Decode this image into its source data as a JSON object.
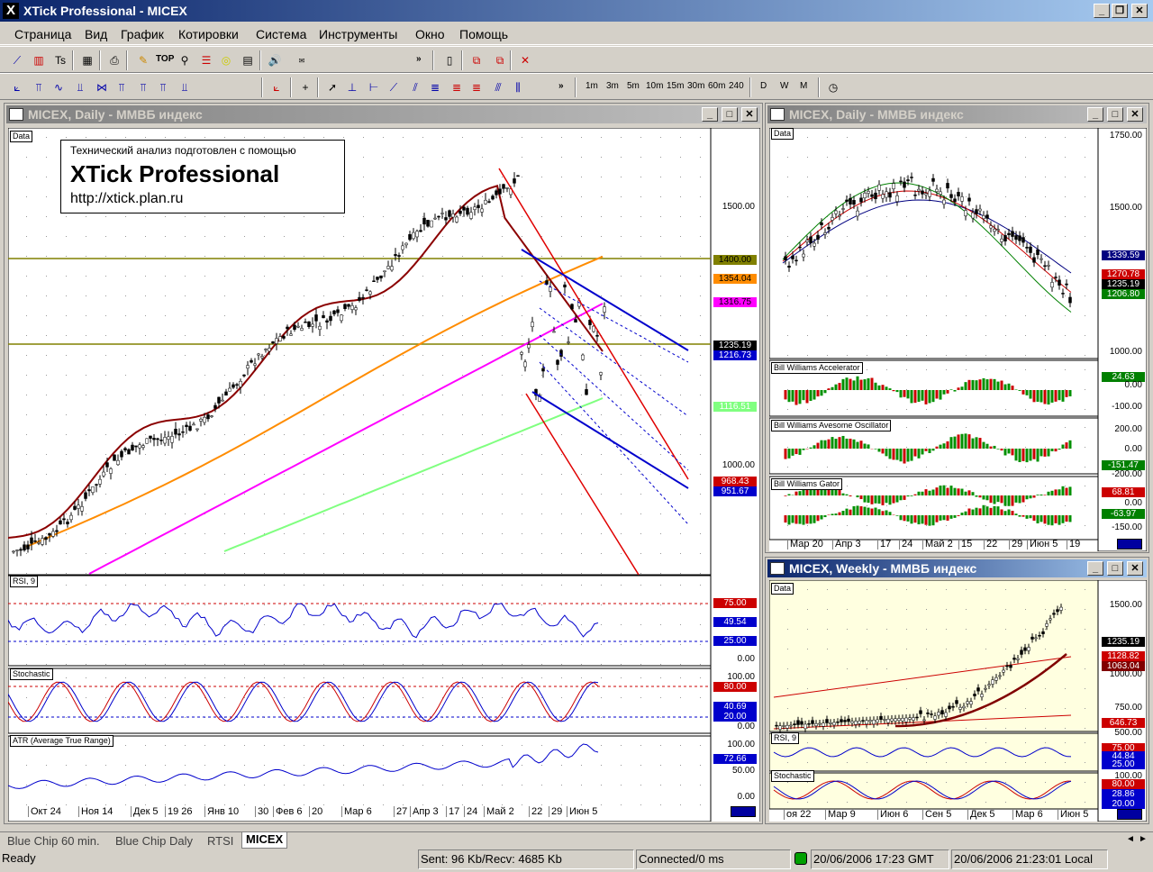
{
  "window": {
    "title": "XTick Professional - MICEX",
    "app_icon": "X"
  },
  "menu": [
    "Страница",
    "Вид",
    "График",
    "Котировки",
    "Система",
    "Инструменты",
    "Окно",
    "Помощь"
  ],
  "toolbar1": {
    "text_buttons": [
      "TOP"
    ]
  },
  "toolbar2": {
    "timeframes": [
      "1m",
      "3m",
      "5m",
      "10m",
      "15m",
      "30m",
      "60m",
      "240",
      "D",
      "W",
      "M"
    ]
  },
  "main_chart": {
    "title": "MICEX, Daily - ММВБ индекс",
    "data_label": "Data",
    "watermark": {
      "line1": "Технический анализ подготовлен с помощью",
      "line2": "XTick Professional",
      "line3": "http://xtick.plan.ru"
    },
    "price_axis": [
      "1500.00",
      "1000.00"
    ],
    "price_tags": [
      {
        "value": "1400.00",
        "bg": "#808000",
        "fg": "#000"
      },
      {
        "value": "1354.04",
        "bg": "#ff8c00",
        "fg": "#000"
      },
      {
        "value": "1316.75",
        "bg": "#ff00ff",
        "fg": "#000"
      },
      {
        "value": "1235.19",
        "bg": "#000000",
        "fg": "#fff"
      },
      {
        "value": "1216.73",
        "bg": "#0000cc",
        "fg": "#fff"
      },
      {
        "value": "1116.51",
        "bg": "#80ff80",
        "fg": "#fff"
      },
      {
        "value": "968.43",
        "bg": "#cc0000",
        "fg": "#fff"
      },
      {
        "value": "951.67",
        "bg": "#0000cc",
        "fg": "#fff"
      }
    ],
    "rsi": {
      "label": "RSI, 9",
      "levels": [
        "75.00",
        "49.54",
        "25.00",
        "0.00"
      ]
    },
    "stochastic": {
      "label": "Stochastic",
      "levels": [
        "100.00",
        "80.00",
        "40.69",
        "20.00",
        "0.00"
      ]
    },
    "atr": {
      "label": "ATR (Average True Range)",
      "levels": [
        "100.00",
        "72.66",
        "50.00",
        "0.00"
      ]
    },
    "dates": [
      "Окт 24",
      "Ноя 14",
      "Дек 5",
      "19 26",
      "Янв 10",
      "30",
      "Фев 6",
      "20",
      "Мар 6",
      "27",
      "Апр 3",
      "17",
      "24",
      "Май 2",
      "22",
      "29",
      "Июн 5"
    ]
  },
  "right_daily": {
    "title": "MICEX, Daily - ММВБ индекс",
    "data_label": "Data",
    "price_axis": [
      "1750.00",
      "1500.00",
      "1000.00"
    ],
    "price_tags": [
      {
        "value": "1339.59",
        "bg": "#000080",
        "fg": "#fff"
      },
      {
        "value": "1270.78",
        "bg": "#cc0000",
        "fg": "#fff"
      },
      {
        "value": "1235.19",
        "bg": "#000000",
        "fg": "#fff"
      },
      {
        "value": "1206.80",
        "bg": "#008000",
        "fg": "#fff"
      }
    ],
    "accelerator": {
      "label": "Bill Williams Accelerator",
      "levels": [
        "24.63",
        "0.00",
        "-100.00"
      ]
    },
    "awesome": {
      "label": "Bill Williams Avesome Oscillator",
      "levels": [
        "200.00",
        "0.00",
        "-151.47",
        "-200.00"
      ]
    },
    "gator": {
      "label": "Bill Williams Gator",
      "levels": [
        "68.81",
        "0.00",
        "-63.97",
        "-150.00"
      ]
    },
    "dates": [
      "Мар 20",
      "Апр 3",
      "17",
      "24",
      "Май 2",
      "15",
      "22",
      "29",
      "Июн 5",
      "19"
    ]
  },
  "right_weekly": {
    "title": "MICEX, Weekly - ММВБ индекс",
    "data_label": "Data",
    "price_axis": [
      "1500.00",
      "1000.00",
      "750.00",
      "500.00"
    ],
    "price_tags": [
      {
        "value": "1235.19",
        "bg": "#000000",
        "fg": "#fff"
      },
      {
        "value": "1128.82",
        "bg": "#cc0000",
        "fg": "#fff"
      },
      {
        "value": "1063.04",
        "bg": "#800000",
        "fg": "#fff"
      },
      {
        "value": "646.73",
        "bg": "#cc0000",
        "fg": "#fff"
      }
    ],
    "rsi": {
      "label": "RSI, 9",
      "levels": [
        "75.00",
        "44.84",
        "25.00"
      ]
    },
    "stochastic": {
      "label": "Stochastic",
      "levels": [
        "100.00",
        "80.00",
        "28.86",
        "20.00"
      ]
    },
    "dates": [
      "оя 22",
      "Мар 9",
      "Июн 6",
      "Сен 5",
      "Дек 5",
      "Мар 6",
      "Июн 5"
    ]
  },
  "sheet_tabs": [
    {
      "label": "Blue Chip 60 min.",
      "active": false
    },
    {
      "label": "Blue Chip Daly",
      "active": false
    },
    {
      "label": "RTSI",
      "active": false
    },
    {
      "label": "MICEX",
      "active": true
    }
  ],
  "status": {
    "ready": "Ready",
    "traffic": "Sent: 96 Kb/Recv: 4685 Kb",
    "connection": "Connected/0 ms",
    "gmt_time": "20/06/2006 17:23 GMT",
    "local_time": "20/06/2006 21:23:01 Local"
  }
}
